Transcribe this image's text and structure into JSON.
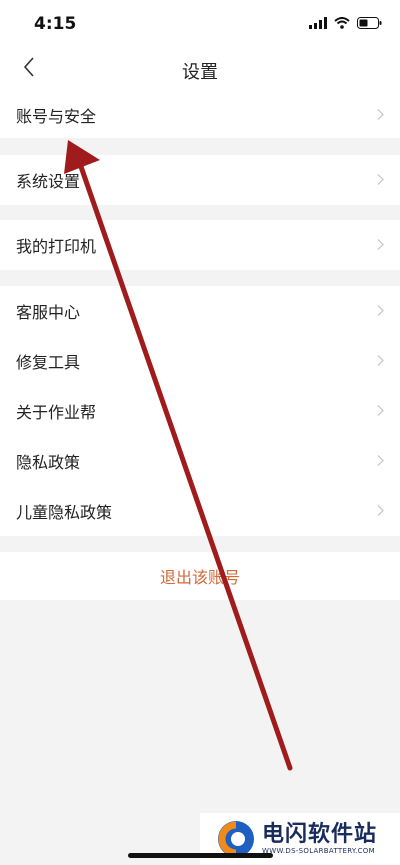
{
  "status_bar": {
    "time": "4:15"
  },
  "nav": {
    "title": "设置"
  },
  "menu": {
    "items": [
      {
        "label": "账号与安全"
      },
      {
        "label": "系统设置"
      },
      {
        "label": "我的打印机"
      },
      {
        "label": "客服中心"
      },
      {
        "label": "修复工具"
      },
      {
        "label": "关于作业帮"
      },
      {
        "label": "隐私政策"
      },
      {
        "label": "儿童隐私政策"
      }
    ],
    "logout_label": "退出该账号"
  },
  "watermark": {
    "title": "电闪软件站",
    "url": "WWW.DS-SOLARBATTERY.COM"
  },
  "colors": {
    "accent": "#d26a3a",
    "arrow": "#a01c1c",
    "background": "#f3f3f3"
  },
  "icons": [
    "signal-icon",
    "wifi-icon",
    "battery-icon",
    "back-icon",
    "chevron-right-icon",
    "annotation-arrow-icon",
    "watermark-logo-icon"
  ]
}
